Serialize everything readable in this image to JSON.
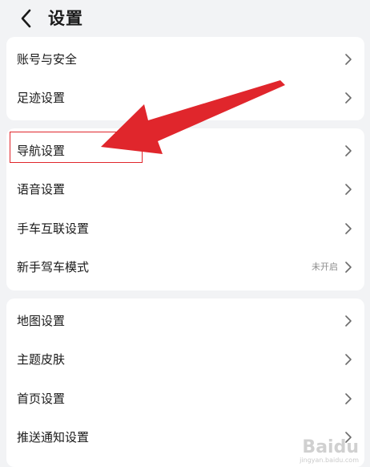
{
  "header": {
    "title": "设置"
  },
  "groups": [
    {
      "items": [
        {
          "label": "账号与安全"
        },
        {
          "label": "足迹设置"
        }
      ]
    },
    {
      "items": [
        {
          "label": "导航设置"
        },
        {
          "label": "语音设置"
        },
        {
          "label": "手车互联设置"
        },
        {
          "label": "新手驾车模式",
          "status": "未开启"
        }
      ]
    },
    {
      "items": [
        {
          "label": "地图设置"
        },
        {
          "label": "主题皮肤"
        },
        {
          "label": "首页设置"
        },
        {
          "label": "推送通知设置"
        }
      ]
    }
  ],
  "annotation": {
    "highlight_color": "#e0262c",
    "arrow_color": "#e0262c"
  },
  "watermark": {
    "text": "Baidu",
    "sub": "jingyan.baidu.com"
  },
  "icons": {
    "back": "back-arrow-icon",
    "chevron": "chevron-right-icon"
  }
}
